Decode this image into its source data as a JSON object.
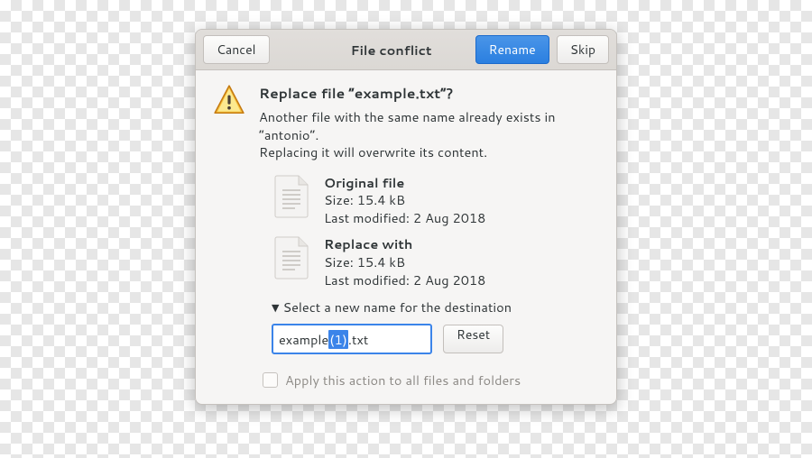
{
  "header": {
    "cancel": "Cancel",
    "title": "File conflict",
    "rename": "Rename",
    "skip": "Skip"
  },
  "prompt": {
    "heading": "Replace file “example.txt”?",
    "line1": "Another file with the same name already exists in “antonio”.",
    "line2": "Replacing it will overwrite its content."
  },
  "original": {
    "label": "Original file",
    "size": "Size: 15.4 kB",
    "modified": "Last modified: 2 Aug 2018"
  },
  "replacement": {
    "label": "Replace with",
    "size": "Size: 15.4 kB",
    "modified": "Last modified: 2 Aug 2018"
  },
  "expander": {
    "label": "Select a new name for the destination"
  },
  "rename": {
    "prefix": "example",
    "selected": "(1)",
    "suffix": ".txt",
    "reset": "Reset"
  },
  "apply_all": {
    "label": "Apply this action to all files and folders",
    "checked": false
  }
}
